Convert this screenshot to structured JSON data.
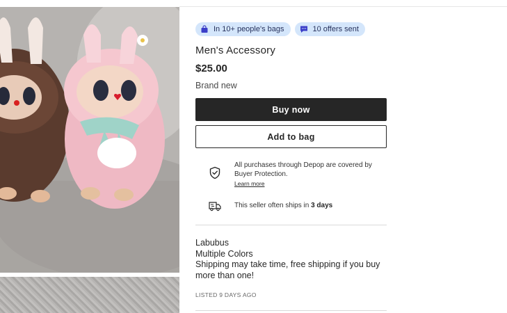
{
  "badges": {
    "bags": {
      "text": "In 10+ people's bags",
      "icon": "bag-icon"
    },
    "offers": {
      "text": "10 offers sent",
      "icon": "chat-icon"
    }
  },
  "product": {
    "title": "Men's Accessory",
    "price": "$25.00",
    "condition": "Brand new"
  },
  "actions": {
    "buy_now": "Buy now",
    "add_to_bag": "Add to bag"
  },
  "protection": {
    "text": "All purchases through Depop are covered by Buyer Protection.",
    "learn_more": "Learn more",
    "icon": "shield-check-icon"
  },
  "shipping": {
    "prefix": "This seller often ships in ",
    "days": "3 days",
    "icon": "truck-icon"
  },
  "description": {
    "lines": [
      "Labubus",
      "Multiple Colors",
      "Shipping may take time, free shipping if you buy more than one!"
    ]
  },
  "listed": "LISTED 9 DAYS AGO",
  "colors": {
    "badge_bg": "#d4e6fb",
    "badge_icon": "#3b3ec8",
    "primary_button": "#262626"
  }
}
